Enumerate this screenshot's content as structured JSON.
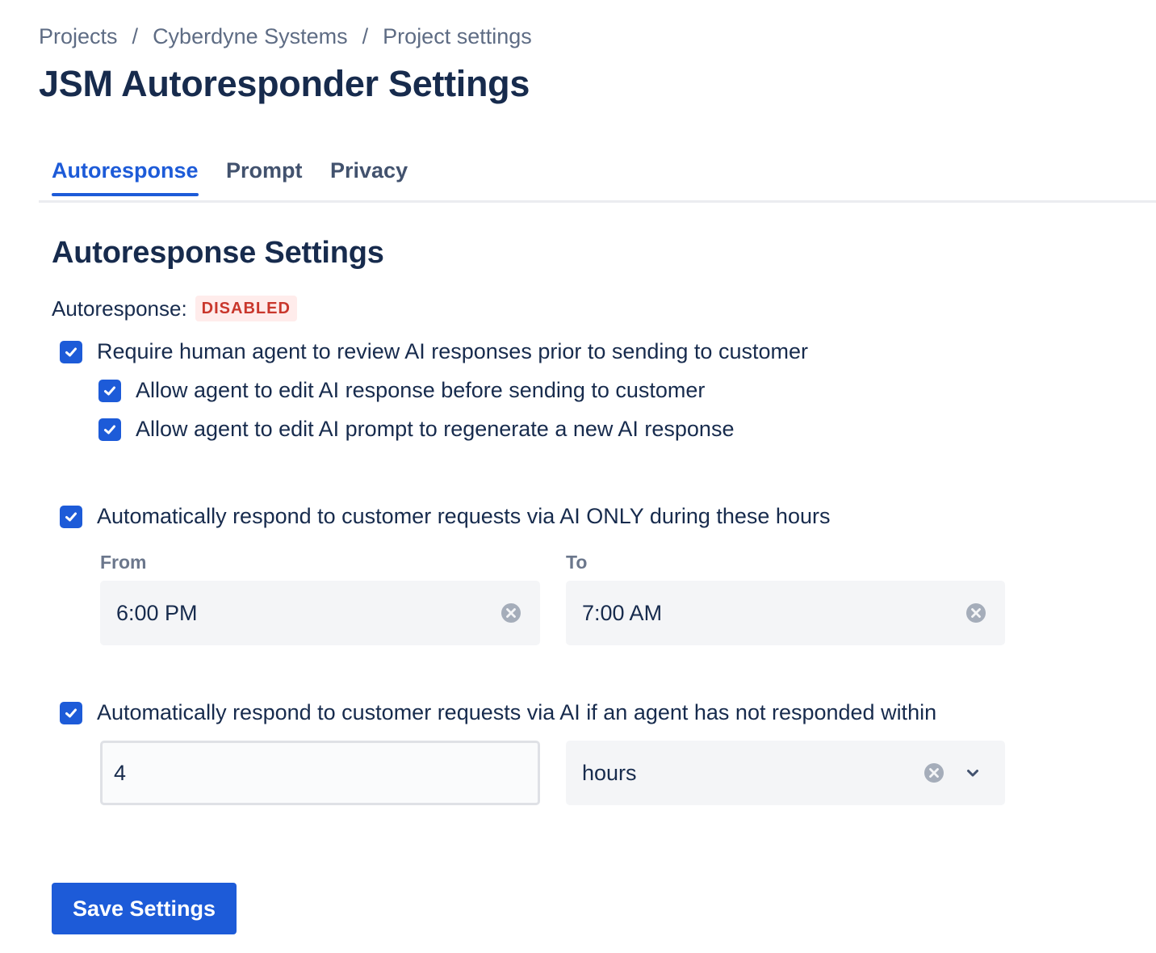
{
  "breadcrumb": {
    "items": [
      "Projects",
      "Cyberdyne Systems",
      "Project settings"
    ],
    "separator": "/"
  },
  "page": {
    "title": "JSM Autoresponder Settings"
  },
  "tabs": [
    {
      "label": "Autoresponse",
      "active": true
    },
    {
      "label": "Prompt",
      "active": false
    },
    {
      "label": "Privacy",
      "active": false
    }
  ],
  "section": {
    "title": "Autoresponse Settings",
    "status_label": "Autoresponse:",
    "status_badge": "DISABLED"
  },
  "options": {
    "require_review": {
      "label": "Require human agent to review AI responses prior to sending to customer",
      "checked": true
    },
    "allow_edit_response": {
      "label": "Allow agent to edit AI response before sending to customer",
      "checked": true
    },
    "allow_edit_prompt": {
      "label": "Allow agent to edit AI prompt to regenerate a new AI response",
      "checked": true
    },
    "hours_only": {
      "label": "Automatically respond to customer requests via AI ONLY during these hours",
      "checked": true
    },
    "no_response": {
      "label": "Automatically respond to customer requests via AI if an agent has not responded within",
      "checked": true
    }
  },
  "hours": {
    "from_label": "From",
    "from_value": "6:00 PM",
    "to_label": "To",
    "to_value": "7:00 AM"
  },
  "timeout": {
    "amount": "4",
    "unit": "hours"
  },
  "actions": {
    "save_label": "Save Settings"
  },
  "colors": {
    "primary": "#1D5BD8",
    "text": "#172B4D",
    "muted": "#5E6C84",
    "danger": "#C9372C",
    "danger_bg": "#FFECEB",
    "field_bg": "#F4F5F7"
  },
  "icons": {
    "checkbox": "checkmark-icon",
    "clear": "clear-icon",
    "dropdown": "chevron-down-icon"
  }
}
